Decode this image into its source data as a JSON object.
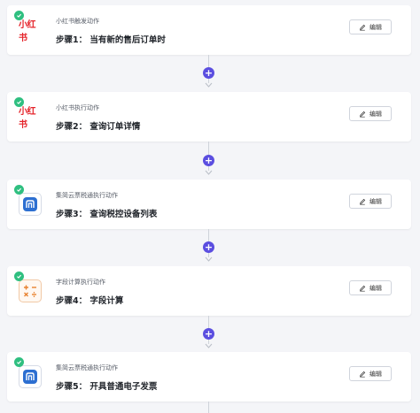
{
  "accent_color": "#5b4ee0",
  "success_color": "#2fbf80",
  "steps": [
    {
      "logo": "xiaohongshu-logo",
      "logo_text": "小红书",
      "subtitle": "小红书触发动作",
      "title": "步骤1： 当有新的售后订单时",
      "edit_label": "编辑"
    },
    {
      "logo": "xiaohongshu-logo",
      "logo_text": "小红书",
      "subtitle": "小红书执行动作",
      "title": "步骤2： 查询订单详情",
      "edit_label": "编辑"
    },
    {
      "logo": "jianyun-invoice-logo",
      "logo_text": "",
      "subtitle": "集简云票税通执行动作",
      "title": "步骤3： 查询税控设备列表",
      "edit_label": "编辑"
    },
    {
      "logo": "calculator-logo",
      "logo_text": "",
      "subtitle": "字段计算执行动作",
      "title": "步骤4： 字段计算",
      "edit_label": "编辑"
    },
    {
      "logo": "jianyun-invoice-logo",
      "logo_text": "",
      "subtitle": "集简云票税通执行动作",
      "title": "步骤5： 开具普通电子发票",
      "edit_label": "编辑"
    }
  ]
}
